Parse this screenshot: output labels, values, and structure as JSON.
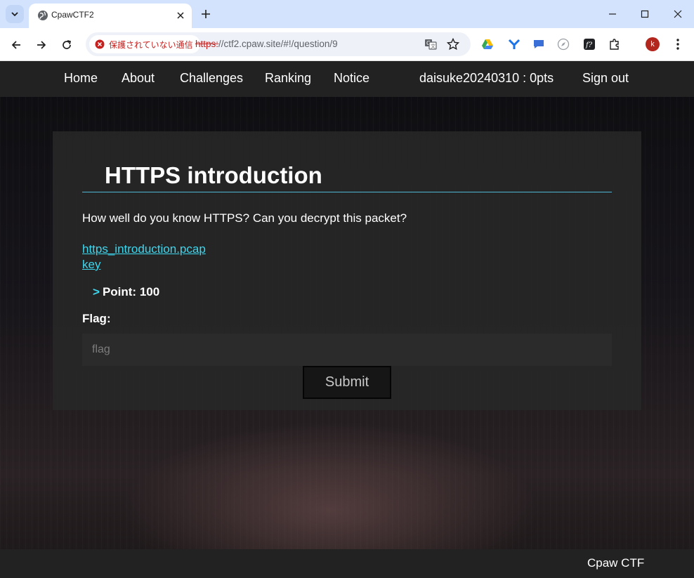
{
  "browser": {
    "tab_title": "CpawCTF2",
    "security_label": "保護されていない通信",
    "url_scheme": "https:",
    "url_rest": "//ctf2.cpaw.site/#!/question/9",
    "profile_initial": "k",
    "icons": [
      "tab-search-icon",
      "globe-icon",
      "close-icon",
      "plus-icon",
      "minimize-icon",
      "maximize-icon",
      "close-window-icon",
      "back-icon",
      "forward-icon",
      "reload-icon",
      "warning-icon",
      "translate-icon",
      "star-icon",
      "drive-icon",
      "extension-icon",
      "puzzle-icon",
      "kebab-menu-icon"
    ]
  },
  "nav": {
    "home": "Home",
    "about": "About",
    "challenges": "Challenges",
    "ranking": "Ranking",
    "notice": "Notice",
    "user": "daisuke20240310 : 0pts",
    "signout": "Sign out"
  },
  "question": {
    "title": "HTTPS introduction",
    "description": "How well do you know HTTPS? Can you decrypt this packet?",
    "files": [
      "https_introduction.pcap",
      "key"
    ],
    "point_chevron": ">",
    "point_label": "Point: 100",
    "flag_label": "Flag:",
    "flag_placeholder": "flag",
    "submit_label": "Submit"
  },
  "footer": {
    "text": "Cpaw CTF"
  },
  "colors": {
    "accent": "#3cd8f0",
    "rule": "#4fb7d4",
    "navbar": "#222222"
  }
}
